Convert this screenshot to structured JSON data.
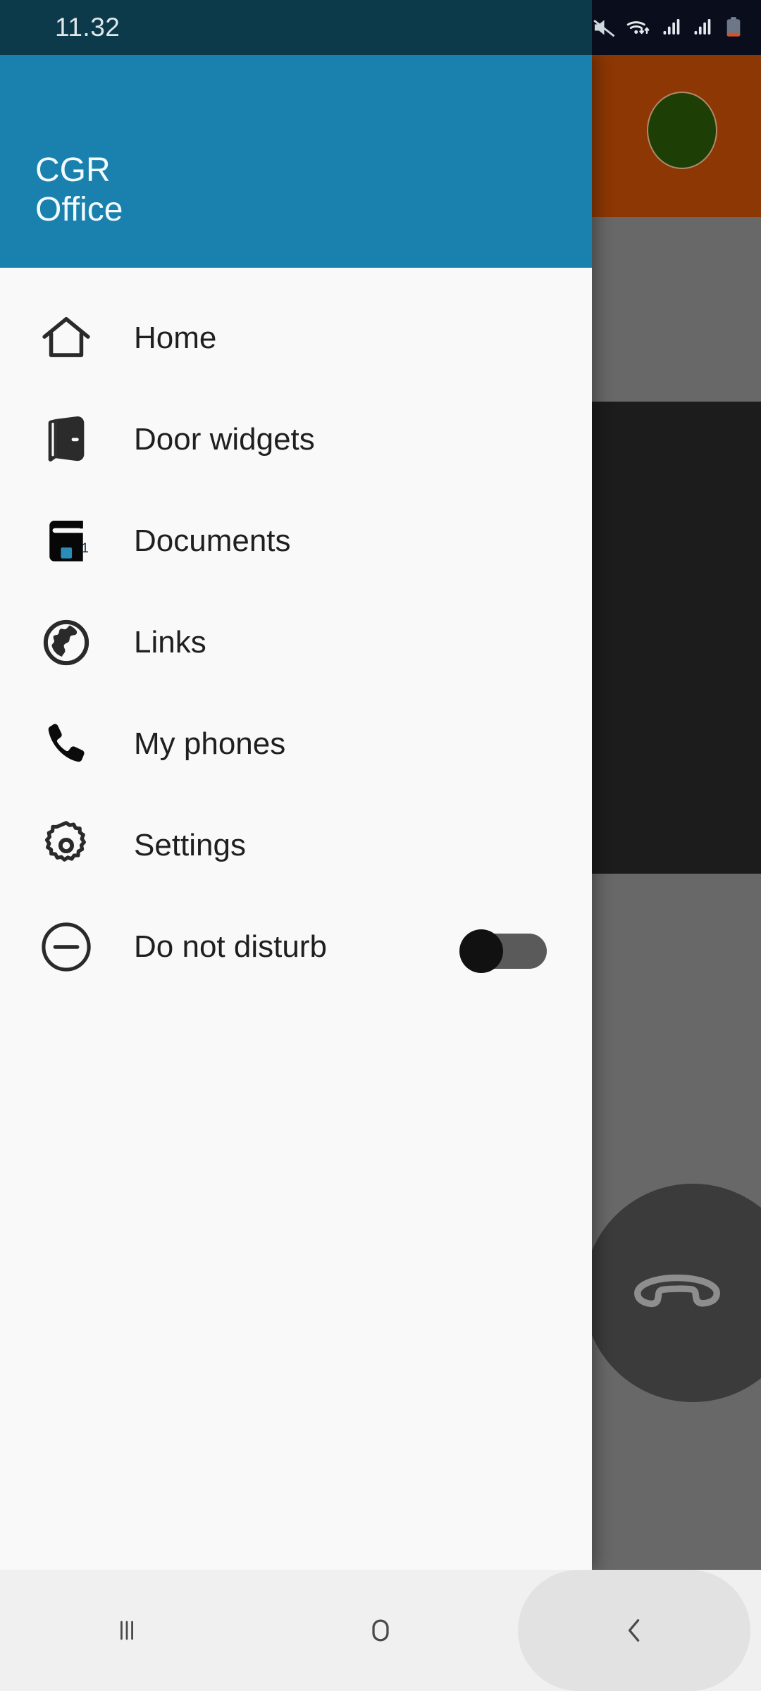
{
  "status_bar": {
    "time": "11.32",
    "icons": [
      {
        "name": "volume-off-icon",
        "label": "Sound muted"
      },
      {
        "name": "wifi-icon",
        "label": "Wi-Fi connected"
      },
      {
        "name": "signal-sim1-icon",
        "label": "Signal SIM 1"
      },
      {
        "name": "signal-sim2-icon",
        "label": "Signal SIM 2"
      },
      {
        "name": "battery-low-icon",
        "label": "Battery low"
      }
    ],
    "bg_left": "#0d3a4a",
    "bg_right": "#0a0d1c",
    "time_color": "#dfe7ea"
  },
  "drawer": {
    "header": {
      "title": "CGR\nOffice",
      "title_line1": "CGR",
      "title_line2": "Office",
      "bg": "#1a80ad",
      "text_color": "#f2fbff"
    },
    "bg": "#f9f9f9",
    "items": [
      {
        "label": "Home",
        "icon": "home-icon",
        "badge": null,
        "toggle": null
      },
      {
        "label": "Door widgets",
        "icon": "door-icon",
        "badge": null,
        "toggle": null
      },
      {
        "label": "Documents",
        "icon": "book-icon",
        "badge": "1",
        "toggle": null
      },
      {
        "label": "Links",
        "icon": "globe-icon",
        "badge": null,
        "toggle": null
      },
      {
        "label": "My phones",
        "icon": "phone-icon",
        "badge": null,
        "toggle": null
      },
      {
        "label": "Settings",
        "icon": "gear-icon",
        "badge": null,
        "toggle": null
      },
      {
        "label": "Do not disturb",
        "icon": "do-not-disturb-icon",
        "badge": null,
        "toggle": "off"
      }
    ],
    "badge_color": "#2b8cb8",
    "toggle_state": "off",
    "toggle_track_color": "#5a5a5a",
    "toggle_thumb_color": "#111111"
  },
  "background_app": {
    "header_band_color": "#8c3704",
    "avatar_color": "#1d3f05",
    "scrim_color": "#686868",
    "dark_band_color": "#1c1c1c",
    "fab": {
      "name": "call-fab",
      "color": "#3b3b3b",
      "icon": "phone-handset-icon"
    }
  },
  "nav_bar": {
    "bg": "#f0f0f0",
    "buttons": [
      {
        "name": "recents-button",
        "icon": "recents-icon",
        "label": "Recents"
      },
      {
        "name": "home-button",
        "icon": "home-square-icon",
        "label": "Home"
      },
      {
        "name": "back-button",
        "icon": "back-chevron-icon",
        "label": "Back",
        "highlighted": true
      }
    ]
  }
}
